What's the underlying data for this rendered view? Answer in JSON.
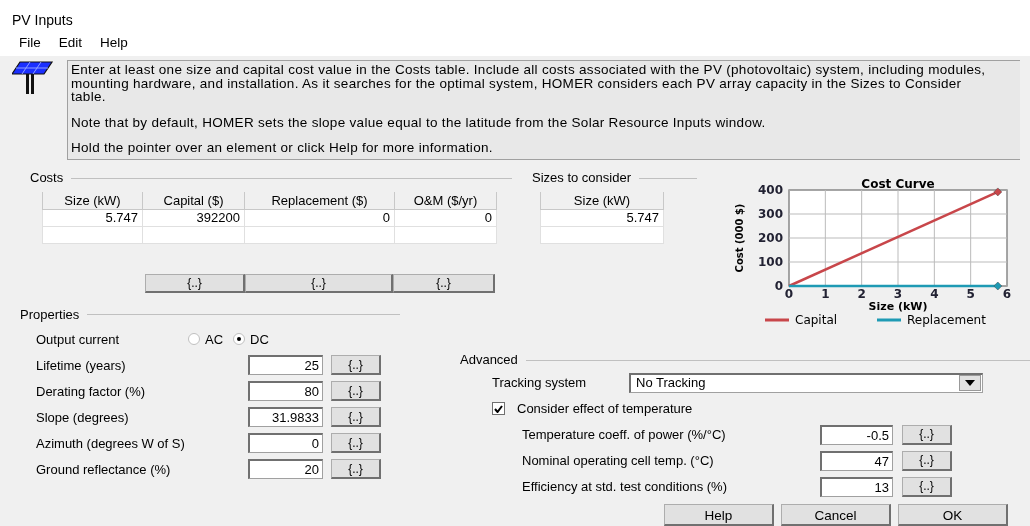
{
  "window": {
    "title": "PV Inputs"
  },
  "menu": [
    "File",
    "Edit",
    "Help"
  ],
  "info": {
    "paragraphs": [
      "Enter at least one size and capital cost value in the Costs table.  Include all costs associated with the PV (photovoltaic) system, including modules, mounting hardware, and installation. As it searches for the optimal system, HOMER considers each PV array capacity in the Sizes to Consider table.",
      "Note that by default, HOMER sets the slope value equal to the latitude from the Solar Resource Inputs window.",
      "Hold the pointer over an element or click Help for more information."
    ]
  },
  "costs": {
    "title": "Costs",
    "columns": [
      "Size (kW)",
      "Capital ($)",
      "Replacement ($)",
      "O&M ($/yr)"
    ],
    "rows": [
      [
        "5.747",
        "392200",
        "0",
        "0"
      ]
    ],
    "buttons": [
      "{..}",
      "{..}",
      "{..}"
    ]
  },
  "sizes": {
    "title": "Sizes to consider",
    "columns": [
      "Size (kW)"
    ],
    "rows": [
      [
        "5.747"
      ]
    ]
  },
  "cost_curve": {
    "chart_data": {
      "type": "line",
      "title": "Cost Curve",
      "xlabel": "Size (kW)",
      "ylabel": "Cost (000 $)",
      "x": [
        0,
        5.747
      ],
      "series": [
        {
          "name": "Capital",
          "color": "#c8464a",
          "values": [
            0,
            392
          ]
        },
        {
          "name": "Replacement",
          "color": "#1e9ab4",
          "values": [
            0,
            0
          ]
        }
      ],
      "grid": true,
      "legend": true,
      "xlim": [
        0,
        6
      ],
      "ylim": [
        0,
        400
      ],
      "xticks": [
        0,
        1,
        2,
        3,
        4,
        5,
        6
      ],
      "yticks": [
        0,
        100,
        200,
        300,
        400
      ]
    }
  },
  "properties": {
    "title": "Properties",
    "output_current": {
      "label": "Output current",
      "options": [
        {
          "label": "AC",
          "selected": false
        },
        {
          "label": "DC",
          "selected": true
        }
      ]
    },
    "fields": [
      {
        "label": "Lifetime (years)",
        "value": "25",
        "button": "{..}"
      },
      {
        "label": "Derating factor (%)",
        "value": "80",
        "button": "{..}"
      },
      {
        "label": "Slope (degrees)",
        "value": "31.9833",
        "button": "{..}"
      },
      {
        "label": "Azimuth (degrees W of S)",
        "value": "0",
        "button": "{..}"
      },
      {
        "label": "Ground reflectance (%)",
        "value": "20",
        "button": "{..}"
      }
    ]
  },
  "advanced": {
    "title": "Advanced",
    "tracking": {
      "label": "Tracking system",
      "value": "No Tracking"
    },
    "temperature": {
      "label": "Consider effect of temperature",
      "checked": true
    },
    "fields": [
      {
        "label": "Temperature coeff. of power (%/°C)",
        "value": "-0.5",
        "button": "{..}"
      },
      {
        "label": "Nominal operating cell temp. (°C)",
        "value": "47",
        "button": "{..}"
      },
      {
        "label": "Efficiency at std. test conditions (%)",
        "value": "13",
        "button": "{..}"
      }
    ]
  },
  "buttons": [
    "Help",
    "Cancel",
    "OK"
  ]
}
